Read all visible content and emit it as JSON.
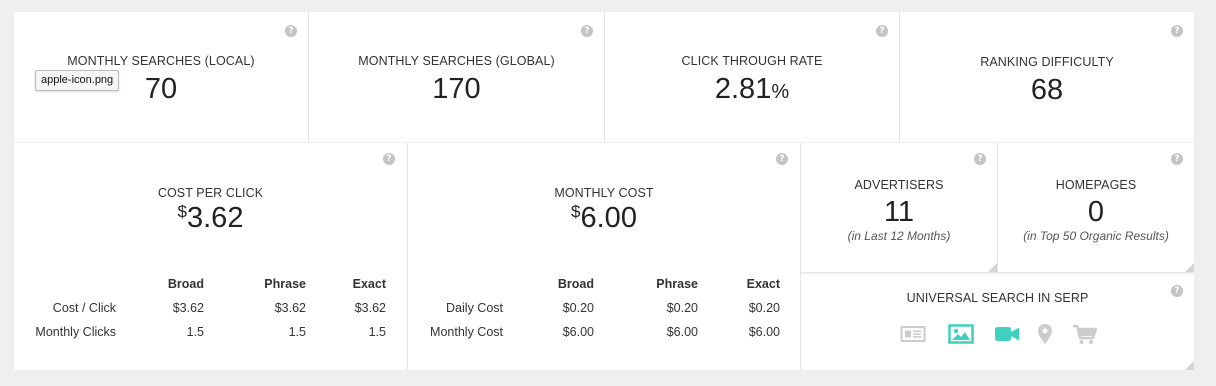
{
  "row1": [
    {
      "label": "MONTHLY SEARCHES (LOCAL)",
      "value": "70"
    },
    {
      "label": "MONTHLY SEARCHES (GLOBAL)",
      "value": "170"
    },
    {
      "label": "CLICK THROUGH RATE",
      "value": "2.81",
      "suffix": "%"
    },
    {
      "label": "RANKING DIFFICULTY",
      "value": "68"
    }
  ],
  "tooltip": "apple-icon.png",
  "help_glyph": "?",
  "cpc": {
    "label": "COST PER CLICK",
    "currency": "$",
    "value": "3.62",
    "headers": [
      "Broad",
      "Phrase",
      "Exact"
    ],
    "rows": [
      {
        "label": "Cost / Click",
        "values": [
          "$3.62",
          "$3.62",
          "$3.62"
        ]
      },
      {
        "label": "Monthly Clicks",
        "values": [
          "1.5",
          "1.5",
          "1.5"
        ]
      }
    ]
  },
  "monthly_cost": {
    "label": "MONTHLY COST",
    "currency": "$",
    "value": "6.00",
    "headers": [
      "Broad",
      "Phrase",
      "Exact"
    ],
    "rows": [
      {
        "label": "Daily Cost",
        "values": [
          "$0.20",
          "$0.20",
          "$0.20"
        ]
      },
      {
        "label": "Monthly Cost",
        "values": [
          "$6.00",
          "$6.00",
          "$6.00"
        ]
      }
    ]
  },
  "advertisers": {
    "label": "ADVERTISERS",
    "value": "11",
    "sub": "(in Last 12 Months)"
  },
  "homepages": {
    "label": "HOMEPAGES",
    "value": "0",
    "sub": "(in Top 50 Organic Results)"
  },
  "serp": {
    "label": "UNIVERSAL SEARCH IN SERP",
    "icons": [
      {
        "name": "news-icon",
        "active": false
      },
      {
        "name": "image-icon",
        "active": true
      },
      {
        "name": "video-icon",
        "active": true
      },
      {
        "name": "map-pin-icon",
        "active": false
      },
      {
        "name": "shopping-cart-icon",
        "active": false
      }
    ],
    "active_color": "#3fd0bf",
    "inactive_color": "#cccccc"
  }
}
